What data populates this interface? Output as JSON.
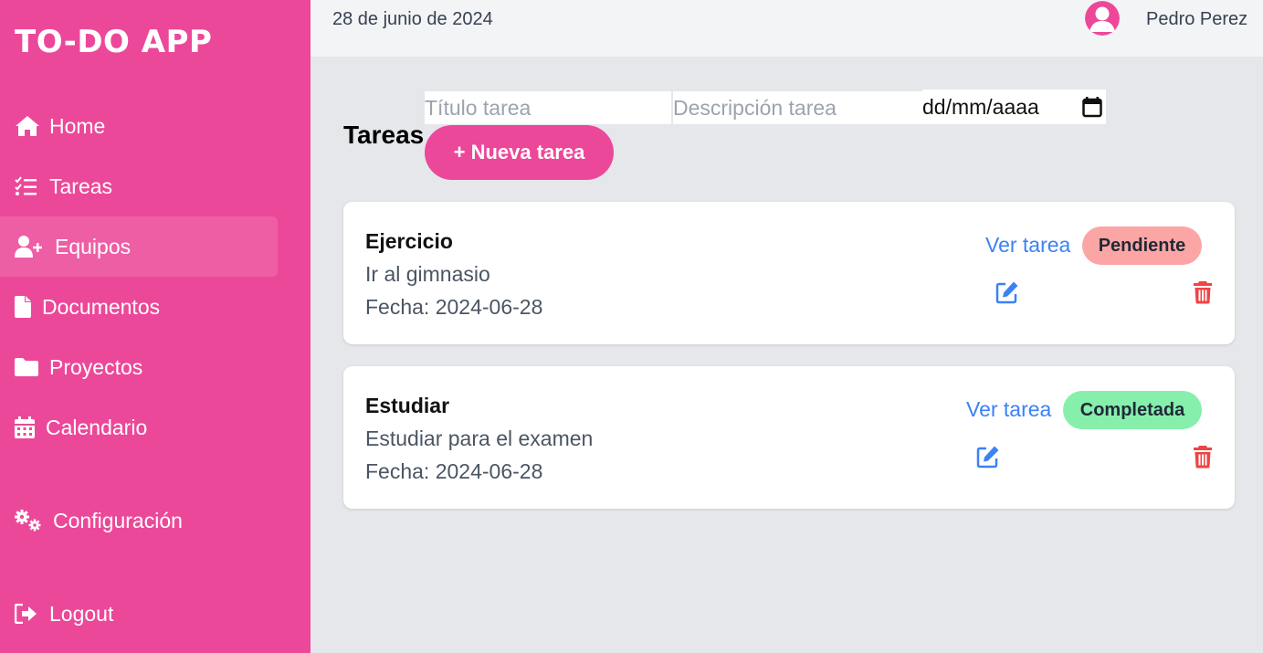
{
  "app": {
    "brand": "TO-DO APP"
  },
  "sidebar": {
    "items": [
      {
        "label": "Home",
        "icon": "home-icon"
      },
      {
        "label": "Tareas",
        "icon": "list-check-icon"
      },
      {
        "label": "Equipos",
        "icon": "user-plus-icon",
        "active": true
      },
      {
        "label": "Documentos",
        "icon": "file-icon"
      },
      {
        "label": "Proyectos",
        "icon": "folder-icon"
      },
      {
        "label": "Calendario",
        "icon": "calendar-icon"
      }
    ],
    "settings": {
      "label": "Configuración",
      "icon": "gears-icon"
    },
    "logout": {
      "label": "Logout",
      "icon": "logout-icon"
    }
  },
  "topbar": {
    "date": "28 de junio de 2024",
    "user_name": "Pedro Perez"
  },
  "form": {
    "title_placeholder": "Título tarea",
    "description_placeholder": "Descripción tarea",
    "date_placeholder": "dd/mm/aaaa"
  },
  "main": {
    "title": "Tareas",
    "new_button": "+ Nueva tarea"
  },
  "tasks": [
    {
      "title": "Ejercicio",
      "description": "Ir al gimnasio",
      "date_text": "Fecha: 2024-06-28",
      "view_label": "Ver tarea",
      "status": "Pendiente"
    },
    {
      "title": "Estudiar",
      "description": "Estudiar para el examen",
      "date_text": "Fecha: 2024-06-28",
      "view_label": "Ver tarea",
      "status": "Completada"
    }
  ],
  "colors": {
    "brand": "#ec4899",
    "link": "#3b82f6",
    "danger": "#ef4444",
    "pending": "#fca5a5",
    "completed": "#86efac"
  }
}
